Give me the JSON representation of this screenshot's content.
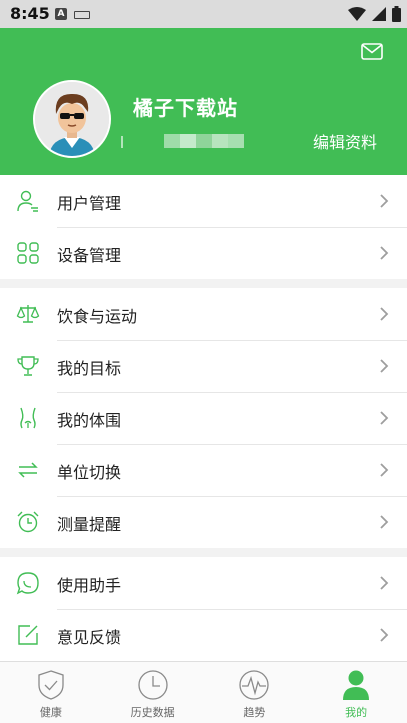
{
  "status_bar": {
    "time": "8:45",
    "notif_letter": "A"
  },
  "profile": {
    "username": "橘子下载站",
    "edit_label": "编辑资料"
  },
  "menu": {
    "section1": [
      {
        "label": "用户管理",
        "icon": "user-manage-icon"
      },
      {
        "label": "设备管理",
        "icon": "device-grid-icon"
      }
    ],
    "section2": [
      {
        "label": "饮食与运动",
        "icon": "scale-balance-icon"
      },
      {
        "label": "我的目标",
        "icon": "trophy-icon"
      },
      {
        "label": "我的体围",
        "icon": "body-figure-icon"
      },
      {
        "label": "单位切换",
        "icon": "swap-arrows-icon"
      },
      {
        "label": "测量提醒",
        "icon": "alarm-clock-icon"
      }
    ],
    "section3": [
      {
        "label": "使用助手",
        "icon": "chat-bubble-icon"
      },
      {
        "label": "意见反馈",
        "icon": "edit-feedback-icon"
      }
    ]
  },
  "bottom_nav": {
    "tabs": [
      {
        "label": "健康",
        "icon": "shield-check-icon",
        "active": false
      },
      {
        "label": "历史数据",
        "icon": "clock-icon",
        "active": false
      },
      {
        "label": "趋势",
        "icon": "pulse-icon",
        "active": false
      },
      {
        "label": "我的",
        "icon": "person-icon",
        "active": true
      }
    ]
  },
  "colors": {
    "primary": "#41bd55",
    "header_bg": "#41bd55",
    "icon": "#41bd55",
    "chevron": "#9e9e9e"
  }
}
